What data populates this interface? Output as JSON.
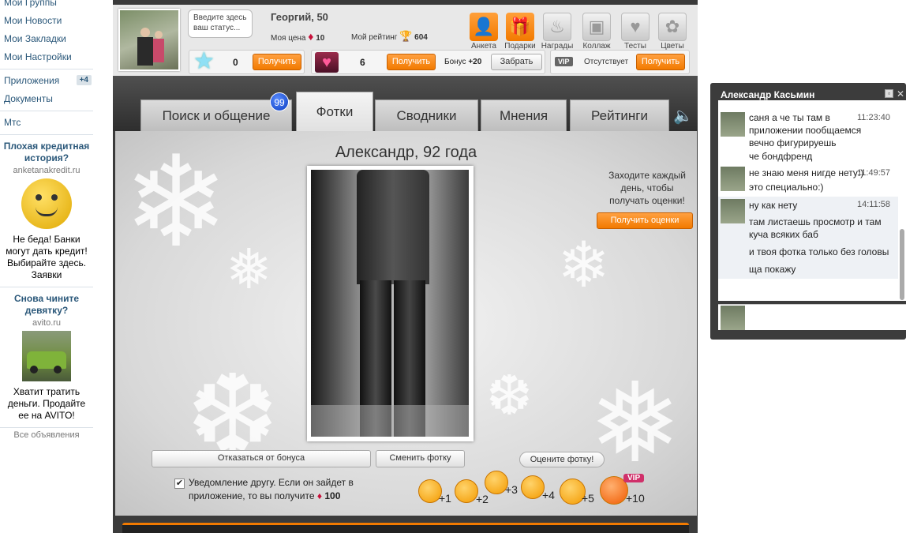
{
  "sidebar": {
    "nav": [
      "Мои Группы",
      "Мои Новости",
      "Мои Закладки",
      "Мои Настройки"
    ],
    "apps_label": "Приложения",
    "apps_badge": "+4",
    "docs_label": "Документы",
    "mts_label": "Мтс",
    "ad1": {
      "title": "Плохая кредитная история?",
      "url": "anketanakredit.ru",
      "text": "Не беда! Банки могут дать кредит! Выбирайте здесь. Заявки"
    },
    "ad2": {
      "title": "Снова чините девятку?",
      "url": "avito.ru",
      "text": "Хватит тратить деньги. Продайте ее на AVITO!"
    },
    "all_ads": "Все объявления"
  },
  "profile": {
    "status_placeholder": "Введите здесь ваш статус...",
    "name": "Георгий, 50",
    "price_label": "Моя цена",
    "price_value": "10",
    "rating_label": "Мой рейтинг",
    "rating_value": "604"
  },
  "counters": {
    "stars_value": "0",
    "get_label": "Получить",
    "hearts_value": "6",
    "bonus_label": "Бонус",
    "bonus_value": "+20",
    "take_label": "Забрать",
    "vip_badge": "VIP",
    "vip_status": "Отсутствует"
  },
  "top_icons": [
    {
      "label": "Анкета",
      "icon": "person-icon"
    },
    {
      "label": "Подарки",
      "icon": "gift-icon"
    },
    {
      "label": "Награды",
      "icon": "medal-icon"
    },
    {
      "label": "Коллаж",
      "icon": "camera-icon"
    },
    {
      "label": "Тесты",
      "icon": "heart-icon"
    },
    {
      "label": "Цветы",
      "icon": "flower-icon"
    }
  ],
  "tabs": [
    {
      "label": "Поиск и общение",
      "badge": "99"
    },
    {
      "label": "Фотки",
      "active": true
    },
    {
      "label": "Сводники"
    },
    {
      "label": "Мнения"
    },
    {
      "label": "Рейтинги"
    }
  ],
  "photo_view": {
    "title": "Александр, 92 года",
    "daily_text": "Заходите каждый день, чтобы получать оценки!",
    "daily_button": "Получить оценки",
    "decline_bonus": "Отказаться от бонуса",
    "change_photo": "Сменить фотку",
    "rate_photo": "Оцените фотку!",
    "notify_text": "Уведомление другу. Если он зайдет в приложение, то вы получите",
    "notify_value": "100",
    "smiles": [
      "+1",
      "+2",
      "+3",
      "+4",
      "+5",
      "+10"
    ],
    "vip_tag": "VIP"
  },
  "chat": {
    "title": "Александр Касьмин",
    "messages": [
      {
        "time": "11:23:40",
        "lines": [
          "саня а че ты там в приложении пообщаемся вечно фигурируешь",
          "че бондфренд"
        ]
      },
      {
        "time": "11:49:57",
        "lines": [
          "не знаю меня нигде нету:)",
          "это специально:)"
        ]
      },
      {
        "time": "14:11:58",
        "lines": [
          "ну как нету",
          "там листаешь просмотр и там куча всяких баб",
          "и твоя фотка только без головы",
          "ща покажу"
        ]
      }
    ]
  },
  "colors": {
    "accent": "#f27a00",
    "link": "#2b587a",
    "chat_bg": "#3c3c3c"
  }
}
